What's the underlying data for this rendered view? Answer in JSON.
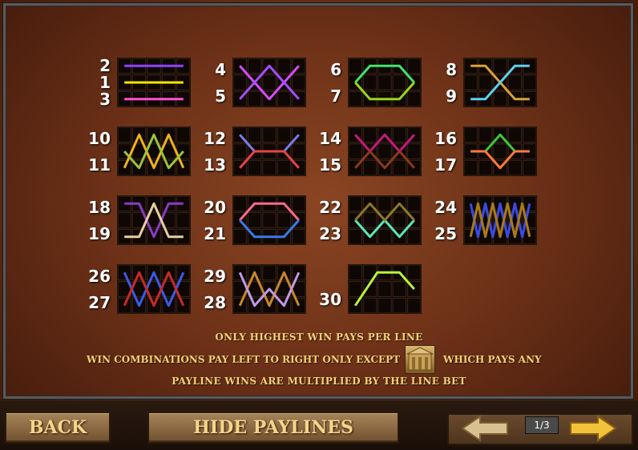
{
  "paylines": [
    {
      "numbers": [
        "2",
        "1",
        "3"
      ],
      "lines": [
        {
          "color": "#8e44ff",
          "path": [
            [
              0,
              0
            ],
            [
              4,
              0
            ]
          ]
        },
        {
          "color": "#f2e600",
          "path": [
            [
              0,
              1
            ],
            [
              4,
              1
            ]
          ]
        },
        {
          "color": "#ff50d2",
          "path": [
            [
              0,
              2
            ],
            [
              4,
              2
            ]
          ]
        }
      ]
    },
    {
      "numbers": [
        "4",
        "5"
      ],
      "lines": [
        {
          "color": "#d44cff",
          "path": [
            [
              0,
              0
            ],
            [
              2,
              2
            ],
            [
              4,
              0
            ]
          ]
        },
        {
          "color": "#a64cff",
          "path": [
            [
              0,
              2
            ],
            [
              2,
              0
            ],
            [
              4,
              2
            ]
          ]
        }
      ]
    },
    {
      "numbers": [
        "6",
        "7"
      ],
      "lines": [
        {
          "color": "#3de66a",
          "path": [
            [
              0,
              1
            ],
            [
              1,
              0
            ],
            [
              3,
              0
            ],
            [
              4,
              1
            ]
          ]
        },
        {
          "color": "#9ad61a",
          "path": [
            [
              0,
              1
            ],
            [
              1,
              2
            ],
            [
              3,
              2
            ],
            [
              4,
              1
            ]
          ]
        }
      ]
    },
    {
      "numbers": [
        "8",
        "9"
      ],
      "lines": [
        {
          "color": "#d8a23a",
          "path": [
            [
              0,
              0
            ],
            [
              1,
              0
            ],
            [
              3,
              2
            ],
            [
              4,
              2
            ]
          ]
        },
        {
          "color": "#5ed0f0",
          "path": [
            [
              0,
              2
            ],
            [
              1,
              2
            ],
            [
              3,
              0
            ],
            [
              4,
              0
            ]
          ]
        }
      ]
    },
    {
      "numbers": [
        "10",
        "11"
      ],
      "lines": [
        {
          "color": "#f2b21a",
          "path": [
            [
              0,
              2
            ],
            [
              1,
              0
            ],
            [
              2,
              2
            ],
            [
              3,
              0
            ],
            [
              4,
              2
            ]
          ]
        },
        {
          "color": "#9ac43a",
          "path": [
            [
              0,
              1
            ],
            [
              1,
              2
            ],
            [
              2,
              0
            ],
            [
              3,
              2
            ],
            [
              4,
              1
            ]
          ]
        }
      ]
    },
    {
      "numbers": [
        "12",
        "13"
      ],
      "lines": [
        {
          "color": "#7a7ae8",
          "path": [
            [
              0,
              0
            ],
            [
              1,
              1
            ],
            [
              3,
              1
            ],
            [
              4,
              0
            ]
          ]
        },
        {
          "color": "#e84444",
          "path": [
            [
              0,
              2
            ],
            [
              1,
              1
            ],
            [
              3,
              1
            ],
            [
              4,
              2
            ]
          ]
        }
      ]
    },
    {
      "numbers": [
        "14",
        "15"
      ],
      "lines": [
        {
          "color": "#c41a7a",
          "path": [
            [
              0,
              0
            ],
            [
              1,
              1
            ],
            [
              2,
              0
            ],
            [
              3,
              1
            ],
            [
              4,
              0
            ]
          ]
        },
        {
          "color": "#8a3a1a",
          "path": [
            [
              0,
              2
            ],
            [
              1,
              1
            ],
            [
              2,
              2
            ],
            [
              3,
              1
            ],
            [
              4,
              2
            ]
          ]
        }
      ]
    },
    {
      "numbers": [
        "16",
        "17"
      ],
      "lines": [
        {
          "color": "#3ac83a",
          "path": [
            [
              0,
              1
            ],
            [
              1,
              1
            ],
            [
              2,
              0
            ],
            [
              3,
              1
            ],
            [
              4,
              1
            ]
          ]
        },
        {
          "color": "#ff7a3a",
          "path": [
            [
              0,
              1
            ],
            [
              1,
              1
            ],
            [
              2,
              2
            ],
            [
              3,
              1
            ],
            [
              4,
              1
            ]
          ]
        }
      ]
    },
    {
      "numbers": [
        "18",
        "19"
      ],
      "lines": [
        {
          "color": "#8a3ac8",
          "path": [
            [
              0,
              0
            ],
            [
              1,
              0
            ],
            [
              2,
              2
            ],
            [
              3,
              0
            ],
            [
              4,
              0
            ]
          ]
        },
        {
          "color": "#e8d0a0",
          "path": [
            [
              0,
              2
            ],
            [
              1,
              2
            ],
            [
              2,
              0
            ],
            [
              3,
              2
            ],
            [
              4,
              2
            ]
          ]
        }
      ]
    },
    {
      "numbers": [
        "20",
        "21"
      ],
      "lines": [
        {
          "color": "#ff6a8a",
          "path": [
            [
              0,
              1
            ],
            [
              1,
              0
            ],
            [
              3,
              0
            ],
            [
              4,
              1
            ]
          ]
        },
        {
          "color": "#3a7ae8",
          "path": [
            [
              0,
              1
            ],
            [
              1,
              2
            ],
            [
              3,
              2
            ],
            [
              4,
              1
            ]
          ]
        }
      ]
    },
    {
      "numbers": [
        "22",
        "23"
      ],
      "lines": [
        {
          "color": "#5ae8b8",
          "path": [
            [
              0,
              1
            ],
            [
              1,
              2
            ],
            [
              2,
              1
            ],
            [
              3,
              2
            ],
            [
              4,
              1
            ]
          ]
        },
        {
          "color": "#8a7a2a",
          "path": [
            [
              0,
              1
            ],
            [
              1,
              0
            ],
            [
              2,
              1
            ],
            [
              3,
              0
            ],
            [
              4,
              1
            ]
          ]
        }
      ]
    },
    {
      "numbers": [
        "24",
        "25"
      ],
      "lines": [
        {
          "color": "#3a4ae8",
          "path": [
            [
              0,
              0
            ],
            [
              0.5,
              2
            ],
            [
              1,
              0
            ],
            [
              1.5,
              2
            ],
            [
              2,
              0
            ],
            [
              2.5,
              2
            ],
            [
              3,
              0
            ],
            [
              3.5,
              2
            ],
            [
              4,
              0
            ]
          ]
        },
        {
          "color": "#a87a1a",
          "path": [
            [
              0,
              2
            ],
            [
              0.5,
              0
            ],
            [
              1,
              2
            ],
            [
              1.5,
              0
            ],
            [
              2,
              2
            ],
            [
              2.5,
              0
            ],
            [
              3,
              2
            ],
            [
              3.5,
              0
            ],
            [
              4,
              2
            ]
          ]
        }
      ]
    },
    {
      "numbers": [
        "26",
        "27"
      ],
      "lines": [
        {
          "color": "#3a5ae8",
          "path": [
            [
              0,
              0
            ],
            [
              1,
              2
            ],
            [
              2,
              0
            ],
            [
              3,
              2
            ],
            [
              4,
              0
            ]
          ]
        },
        {
          "color": "#c82a2a",
          "path": [
            [
              0,
              2
            ],
            [
              1,
              0
            ],
            [
              2,
              2
            ],
            [
              3,
              0
            ],
            [
              4,
              2
            ]
          ]
        }
      ]
    },
    {
      "numbers": [
        "29",
        "28"
      ],
      "lines": [
        {
          "color": "#c8882a",
          "path": [
            [
              0,
              2
            ],
            [
              1,
              0
            ],
            [
              2,
              2
            ],
            [
              3,
              0
            ],
            [
              4,
              2
            ]
          ]
        },
        {
          "color": "#c09ae8",
          "path": [
            [
              0,
              0
            ],
            [
              1,
              2
            ],
            [
              2,
              1
            ],
            [
              3,
              2
            ],
            [
              4,
              0
            ]
          ]
        }
      ]
    },
    {
      "numbers": [
        "30"
      ],
      "lines": [
        {
          "color": "#b8f23a",
          "path": [
            [
              0,
              2
            ],
            [
              1.5,
              0
            ],
            [
              3,
              0
            ],
            [
              4,
              1
            ]
          ]
        }
      ]
    }
  ],
  "info": {
    "line1": "ONLY HIGHEST WIN PAYS PER LINE",
    "line2_left": "WIN COMBINATIONS PAY LEFT TO RIGHT ONLY EXCEPT",
    "line2_right": "WHICH PAYS ANY",
    "line3": "PAYLINE WINS ARE MULTIPLIED BY THE LINE BET"
  },
  "buttons": {
    "back": "BACK",
    "hide_paylines": "HIDE PAYLINES",
    "page": "1/3"
  },
  "colors": {
    "gold_text": "#f2d27a",
    "arrow_prev": "#d8c090",
    "arrow_next": "#f2c23a"
  }
}
